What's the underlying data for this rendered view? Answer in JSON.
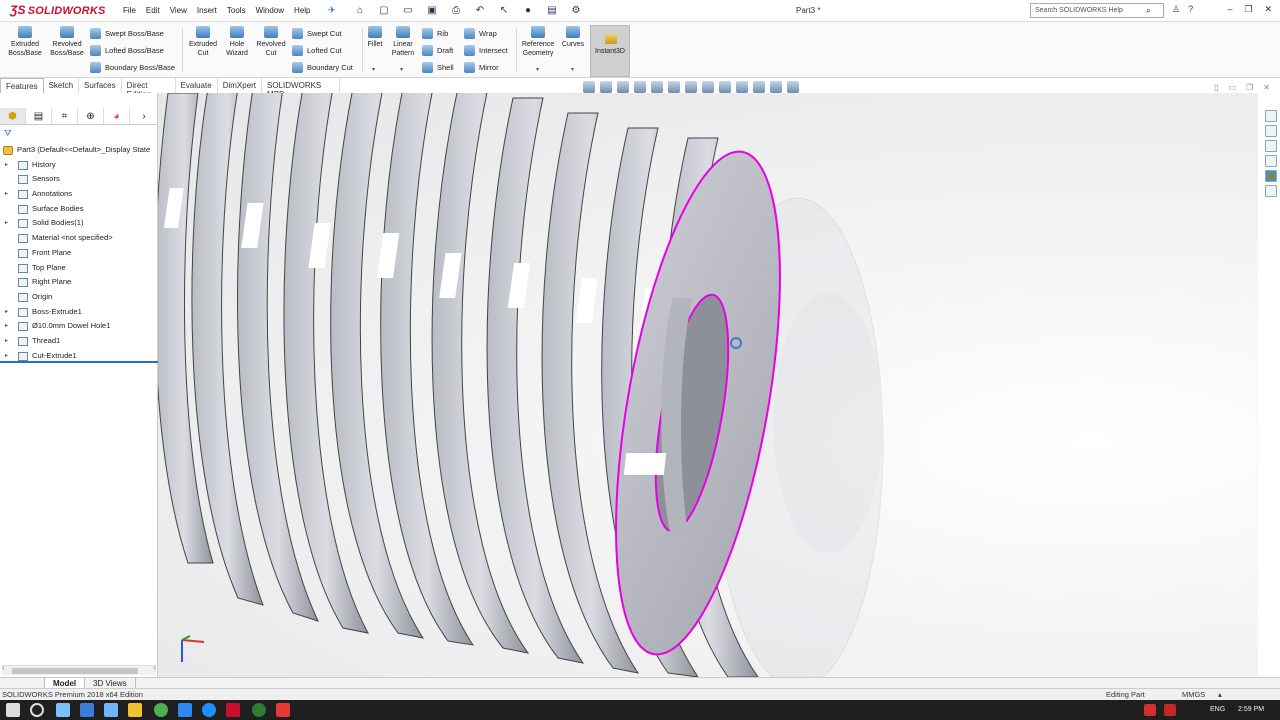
{
  "app": {
    "logo": "SOLIDWORKS",
    "doc_title": "Part3 *"
  },
  "menu": [
    "File",
    "Edit",
    "View",
    "Insert",
    "Tools",
    "Window",
    "Help"
  ],
  "search": {
    "placeholder": "Search SOLIDWORKS Help"
  },
  "ribbon": {
    "extruded_boss": "Extruded Boss/Base",
    "revolved_boss": "Revolved Boss/Base",
    "swept_boss": "Swept Boss/Base",
    "lofted_boss": "Lofted Boss/Base",
    "boundary_boss": "Boundary Boss/Base",
    "extruded_cut": "Extruded Cut",
    "hole_wizard": "Hole Wizard",
    "revolved_cut": "Revolved Cut",
    "swept_cut": "Swept Cut",
    "lofted_cut": "Lofted Cut",
    "boundary_cut": "Boundary Cut",
    "fillet": "Fillet",
    "linear_pattern": "Linear Pattern",
    "rib": "Rib",
    "draft": "Draft",
    "shell": "Shell",
    "wrap": "Wrap",
    "intersect": "Intersect",
    "mirror": "Mirror",
    "reference_geometry": "Reference Geometry",
    "curves": "Curves",
    "instant3d": "Instant3D"
  },
  "tabs": [
    "Features",
    "Sketch",
    "Surfaces",
    "Direct Editing",
    "Evaluate",
    "DimXpert",
    "SOLIDWORKS MBD"
  ],
  "tree": {
    "root": "Part3  (Default<<Default>_Display State",
    "items": [
      "History",
      "Sensors",
      "Annotations",
      "Surface Bodies",
      "Solid Bodies(1)",
      "Material <not specified>",
      "Front Plane",
      "Top Plane",
      "Right Plane",
      "Origin",
      "Boss-Extrude1",
      "Ø10.0mm Dowel Hole1",
      "Thread1",
      "Cut-Extrude1"
    ]
  },
  "bottom_tabs": {
    "model": "Model",
    "views3d": "3D Views"
  },
  "status": {
    "edition": "SOLIDWORKS Premium 2018 x64 Edition",
    "mode": "Editing Part",
    "units": "MMGS"
  },
  "taskbar": {
    "lang": "ENG",
    "time": "2:59 PM"
  },
  "colors": {
    "highlight_edge": "#e600e6",
    "brand": "#c8102e"
  }
}
